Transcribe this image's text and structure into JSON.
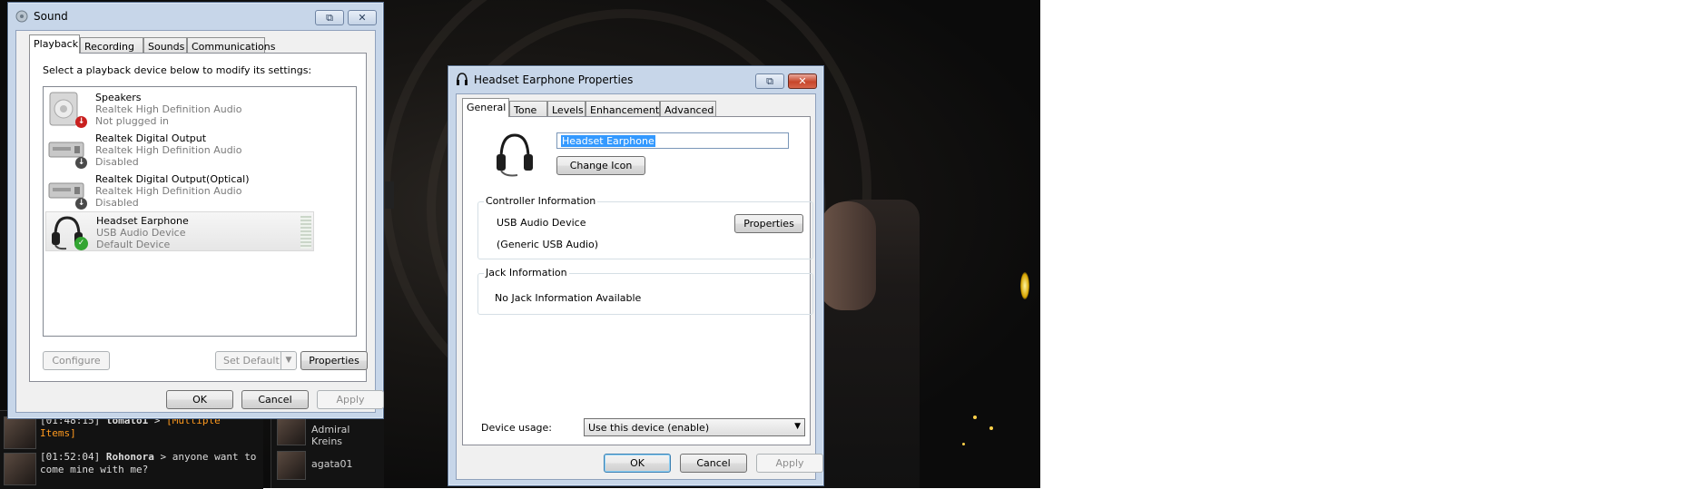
{
  "sound": {
    "title": "Sound",
    "tabs": [
      {
        "label": "Playback"
      },
      {
        "label": "Recording"
      },
      {
        "label": "Sounds"
      },
      {
        "label": "Communications"
      }
    ],
    "instruction": "Select a playback device below to modify its settings:",
    "devices": [
      {
        "name": "Speakers",
        "driver": "Realtek High Definition Audio",
        "status": "Not plugged in",
        "icon": "speaker-icon",
        "badge": "unplugged-icon"
      },
      {
        "name": "Realtek Digital Output",
        "driver": "Realtek High Definition Audio",
        "status": "Disabled",
        "icon": "digital-output-icon",
        "badge": "disabled-icon"
      },
      {
        "name": "Realtek Digital Output(Optical)",
        "driver": "Realtek High Definition Audio",
        "status": "Disabled",
        "icon": "digital-output-icon",
        "badge": "disabled-icon"
      },
      {
        "name": "Headset Earphone",
        "driver": "USB Audio Device",
        "status": "Default Device",
        "icon": "headset-icon",
        "badge": "default-check-icon"
      }
    ],
    "buttons": {
      "configure": "Configure",
      "set_default": "Set Default",
      "properties": "Properties",
      "ok": "OK",
      "cancel": "Cancel",
      "apply": "Apply"
    }
  },
  "props": {
    "title": "Headset Earphone Properties",
    "tabs": [
      {
        "label": "General"
      },
      {
        "label": "Tone"
      },
      {
        "label": "Levels"
      },
      {
        "label": "Enhancements"
      },
      {
        "label": "Advanced"
      }
    ],
    "device_name": "Headset Earphone",
    "change_icon": "Change Icon",
    "controller": {
      "legend": "Controller Information",
      "device": "USB Audio Device",
      "driver": "(Generic USB Audio)",
      "properties": "Properties"
    },
    "jack": {
      "legend": "Jack Information",
      "text": "No Jack Information Available"
    },
    "device_usage_label": "Device usage:",
    "device_usage_value": "Use this device (enable)",
    "buttons": {
      "ok": "OK",
      "cancel": "Cancel",
      "apply": "Apply"
    }
  },
  "chat": {
    "messages": [
      {
        "time": "[01:48:15]",
        "user": "tomato1",
        "sep": ">",
        "text": "[Multiple Items]"
      },
      {
        "time": "[01:52:04]",
        "user": "Rohonora",
        "sep": ">",
        "text": "anyone want to come mine with me?"
      }
    ],
    "members": [
      "Admiral Kreins",
      "agata01"
    ]
  },
  "colors": {
    "chat_link": "#ff9a1f",
    "selection": "#3399ff",
    "default_badge": "#33a532",
    "disabled_badge": "#4a4a4a",
    "unplugged_badge": "#c9201f"
  }
}
